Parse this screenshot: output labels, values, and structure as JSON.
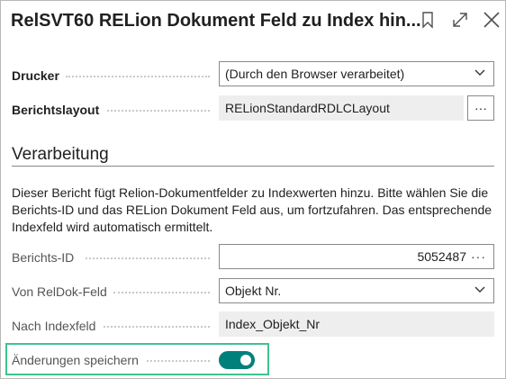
{
  "dialog": {
    "title": "RelSVT60 RELion Dokument Feld zu Index hin...",
    "icons": [
      "bookmark-icon",
      "expand-icon",
      "close-icon"
    ]
  },
  "options": {
    "printer_label": "Drucker",
    "printer_value": "(Durch den Browser verarbeitet)",
    "layout_label": "Berichtslayout",
    "layout_value": "RELionStandardRDLCLayout",
    "layout_button": "···"
  },
  "processing": {
    "heading": "Verarbeitung",
    "description": "Dieser Bericht fügt Relion-Dokumentfelder zu Indexwerten hinzu. Bitte wählen Sie die Berichts-ID und das RELion Dokument Feld aus, um fortzufahren. Das entsprechende Indexfeld wird automatisch ermittelt.",
    "report_id_label": "Berichts-ID",
    "report_id_value": "5052487",
    "report_id_button": "···",
    "from_field_label": "Von RelDok-Feld",
    "from_field_value": "Objekt Nr.",
    "to_field_label": "Nach Indexfeld",
    "to_field_value": "Index_Objekt_Nr",
    "save_changes_label": "Änderungen speichern",
    "save_changes_on": true
  },
  "colors": {
    "toggle_on": "#00807b",
    "highlight": "#3fc28f"
  }
}
